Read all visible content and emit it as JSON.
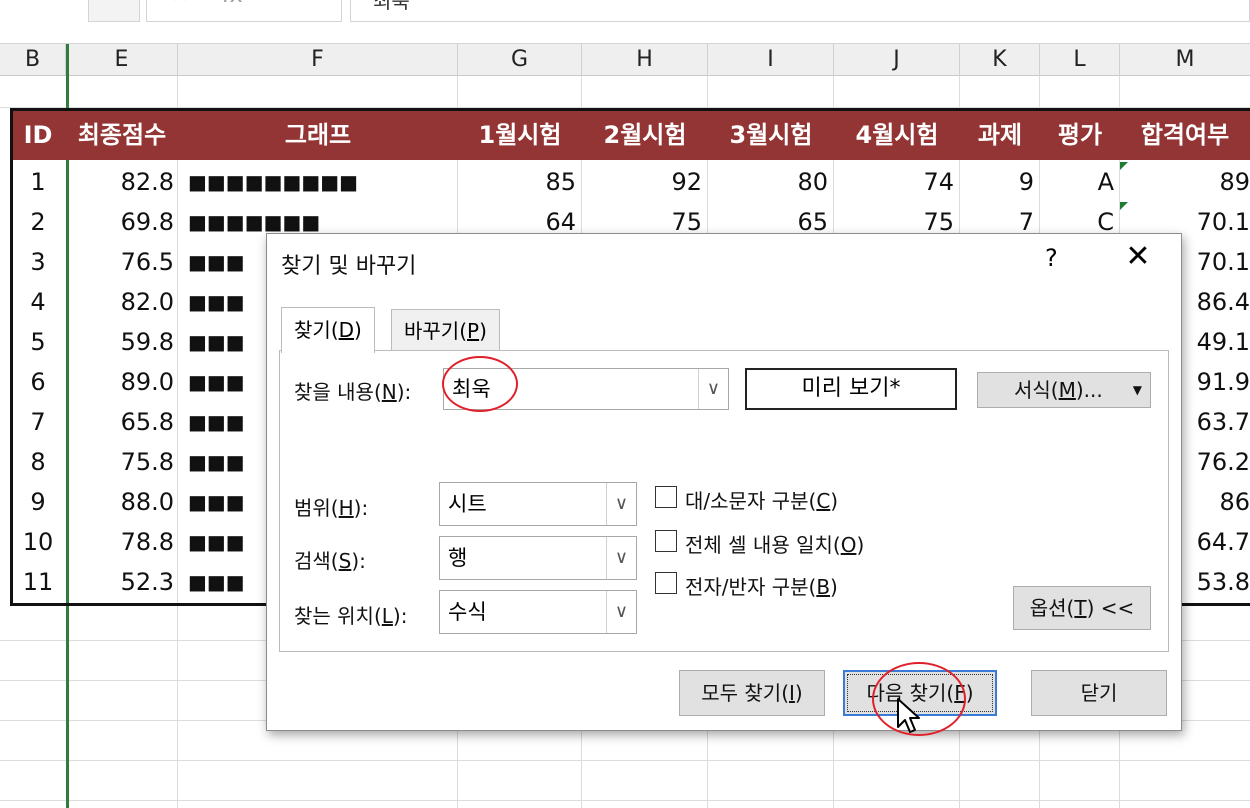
{
  "formula_bar": {
    "tool_glyphs": "✕  ✓  fx",
    "formula_text": "최욱"
  },
  "columns": [
    "B",
    "E",
    "F",
    "G",
    "H",
    "I",
    "J",
    "K",
    "L",
    "M"
  ],
  "table": {
    "header_color": "#933535",
    "headers": [
      "ID",
      "최종점수",
      "그래프",
      "1월시험",
      "2월시험",
      "3월시험",
      "4월시험",
      "과제",
      "평가",
      "합격여부"
    ],
    "rows": [
      {
        "id": "1",
        "score": "82.8",
        "graph": "■■■■■■■■■",
        "jan": "85",
        "feb": "92",
        "mar": "80",
        "apr": "74",
        "hw": "9",
        "grade": "A",
        "pass": "89"
      },
      {
        "id": "2",
        "score": "69.8",
        "graph": "■■■■■■■",
        "jan": "64",
        "feb": "75",
        "mar": "65",
        "apr": "75",
        "hw": "7",
        "grade": "C",
        "pass": "70.1"
      },
      {
        "id": "3",
        "score": "76.5",
        "graph": "■■■",
        "pass": "70.1"
      },
      {
        "id": "4",
        "score": "82.0",
        "graph": "■■■",
        "pass": "86.4"
      },
      {
        "id": "5",
        "score": "59.8",
        "graph": "■■■",
        "pass": "49.1"
      },
      {
        "id": "6",
        "score": "89.0",
        "graph": "■■■",
        "pass": "91.9"
      },
      {
        "id": "7",
        "score": "65.8",
        "graph": "■■■",
        "pass": "63.7"
      },
      {
        "id": "8",
        "score": "75.8",
        "graph": "■■■",
        "pass": "76.2"
      },
      {
        "id": "9",
        "score": "88.0",
        "graph": "■■■",
        "pass": "86"
      },
      {
        "id": "10",
        "score": "78.8",
        "graph": "■■■",
        "pass": "64.7"
      },
      {
        "id": "11",
        "score": "52.3",
        "graph": "■■■",
        "pass": "53.8"
      }
    ]
  },
  "dialog": {
    "title": "찾기 및 바꾸기",
    "help": "?",
    "close": "✕",
    "tabs": {
      "find": "찾기",
      "find_key": "D",
      "replace": "바꾸기",
      "replace_key": "P"
    },
    "find_what_label": "찾을 내용(",
    "find_what_key": "N",
    "find_what_suffix": "):",
    "find_what_value": "최욱",
    "preview": "미리 보기*",
    "format_button": "서식(",
    "format_key": "M",
    "format_suffix": ")...",
    "within_label": "범위(",
    "within_key": "H",
    "within_value": "시트",
    "search_label": "검색(",
    "search_key": "S",
    "search_value": "행",
    "lookin_label": "찾는 위치(",
    "lookin_key": "L",
    "lookin_value": "수식",
    "match_case": "대/소문자 구분(",
    "match_case_key": "C",
    "match_entire": "전체 셀 내용 일치(",
    "match_entire_key": "O",
    "match_byte": "전자/반자 구분(",
    "match_byte_key": "B",
    "options_button": "옵션(",
    "options_key": "T",
    "options_suffix": ") <<",
    "find_all": "모두 찾기(",
    "find_all_key": "I",
    "find_next": "다음 찾기(",
    "find_next_key": "F",
    "close_button": "닫기",
    "annotation_color": "#e0202a"
  }
}
